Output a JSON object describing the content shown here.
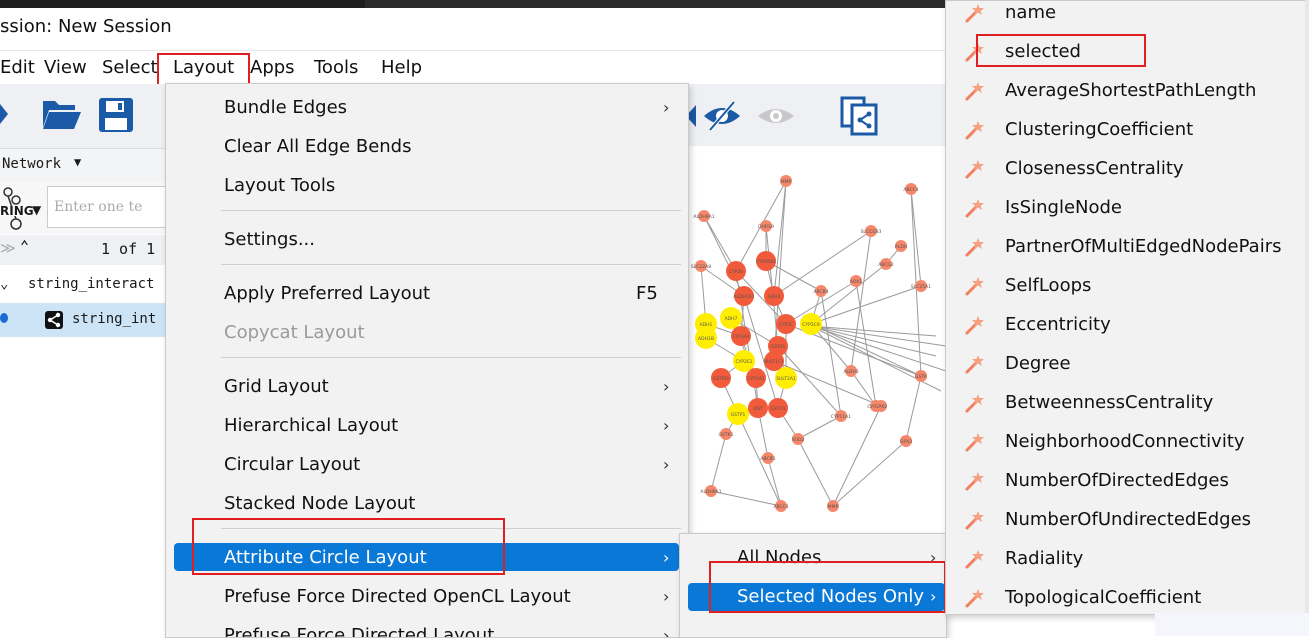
{
  "window": {
    "title": "ssion: New Session"
  },
  "menubar": [
    "Edit",
    "View",
    "Select",
    "Layout",
    "Apps",
    "Tools",
    "Help"
  ],
  "network_panel": {
    "network_label": "Network",
    "search_placeholder": "Enter one te",
    "string_logo_text": "RING",
    "pager": "1 of 1",
    "tree_items": [
      "string_interact",
      "string_int"
    ]
  },
  "layout_menu": {
    "items": [
      {
        "label": "Bundle Edges",
        "submenu": true
      },
      {
        "label": "Clear All Edge Bends"
      },
      {
        "label": "Layout Tools"
      },
      {
        "label": "Settings..."
      },
      {
        "label": "Apply Preferred Layout",
        "shortcut": "F5"
      },
      {
        "label": "Copycat Layout",
        "disabled": true
      },
      {
        "label": "Grid Layout",
        "submenu": true
      },
      {
        "label": "Hierarchical Layout",
        "submenu": true
      },
      {
        "label": "Circular Layout",
        "submenu": true
      },
      {
        "label": "Stacked Node Layout"
      },
      {
        "label": "Attribute Circle Layout",
        "submenu": true,
        "highlighted": true
      },
      {
        "label": "Prefuse Force Directed OpenCL Layout",
        "submenu": true
      },
      {
        "label": "Prefuse Force Directed Layout",
        "submenu": true
      }
    ]
  },
  "attribute_submenu": {
    "items": [
      {
        "label": "All Nodes",
        "submenu": true
      },
      {
        "label": "Selected Nodes Only",
        "submenu": true,
        "highlighted": true
      }
    ]
  },
  "attribute_list": {
    "icon": "magic-wand-icon",
    "items": [
      "name",
      "selected",
      "AverageShortestPathLength",
      "ClusteringCoefficient",
      "ClosenessCentrality",
      "IsSingleNode",
      "PartnerOfMultiEdgedNodePairs",
      "SelfLoops",
      "Eccentricity",
      "Degree",
      "BetweennessCentrality",
      "NeighborhoodConnectivity",
      "NumberOfDirectedEdges",
      "NumberOfUndirectedEdges",
      "Radiality",
      "TopologicalCoefficient"
    ]
  },
  "network_nodes": [
    "MMP",
    "ABCC4",
    "ALDH9A1",
    "DHRS9",
    "SLCO1B3",
    "ALDH",
    "SLC22A8",
    "CYP26",
    "CYP26A1",
    "AOX1",
    "ABCG2",
    "SLC25A1",
    "ALDH1A1",
    "ADH4",
    "ABCB4",
    "ADH1",
    "ADH7",
    "CYP2C",
    "CYP2C9",
    "ADH1B",
    "CYP3A4",
    "GSTA1",
    "CYP2E1",
    "SULT1C1",
    "ALDH3",
    "GSTM3",
    "CYP1A2",
    "SULT2A1",
    "CYP1A1",
    "GSTK",
    "GSTP1",
    "UGT",
    "GSTO1",
    "CYP11A1",
    "GPX2",
    "GPX3",
    "GSTK1",
    "ABCB1",
    "SOD2"
  ],
  "colors": {
    "accent": "#0a78d7",
    "highlight_box": "#e02020",
    "node_yellow": "#ffee00",
    "node_orange": "#f15a3a",
    "node_salmon": "#f5876a"
  }
}
